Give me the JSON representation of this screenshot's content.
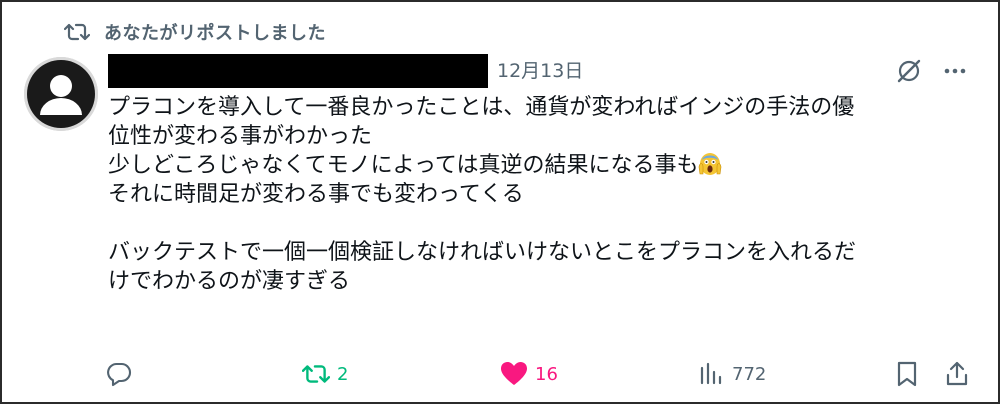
{
  "repost_header": {
    "label": "あなたがリポストしました",
    "icon": "repost-icon"
  },
  "post": {
    "author_name_redacted": true,
    "date": "12月13日",
    "text_lines": [
      "プラコンを導入して一番良かったことは、通貨が変わればインジの手法の優",
      "位性が変わる事がわかった",
      "少しどころじゃなくてモノによっては真逆の結果になる事も",
      "それに時間足が変わる事でも変わってくる",
      "",
      "バックテストで一個一個検証しなければいけないとこをプラコンを入れるだ",
      "けでわかるのが凄すぎる"
    ],
    "emoji_name": "screaming-face-emoji"
  },
  "actions": {
    "reply": {
      "icon": "reply-icon"
    },
    "repost": {
      "icon": "repost-icon",
      "count": "2"
    },
    "like": {
      "icon": "heart-icon",
      "count": "16"
    },
    "views": {
      "icon": "views-icon",
      "count": "772"
    },
    "bookmark": {
      "icon": "bookmark-icon"
    },
    "share": {
      "icon": "share-icon"
    }
  },
  "colors": {
    "secondary_text": "#536471",
    "repost_green": "#00ba7c",
    "like_pink": "#f91880",
    "primary_text": "#0f1419"
  }
}
